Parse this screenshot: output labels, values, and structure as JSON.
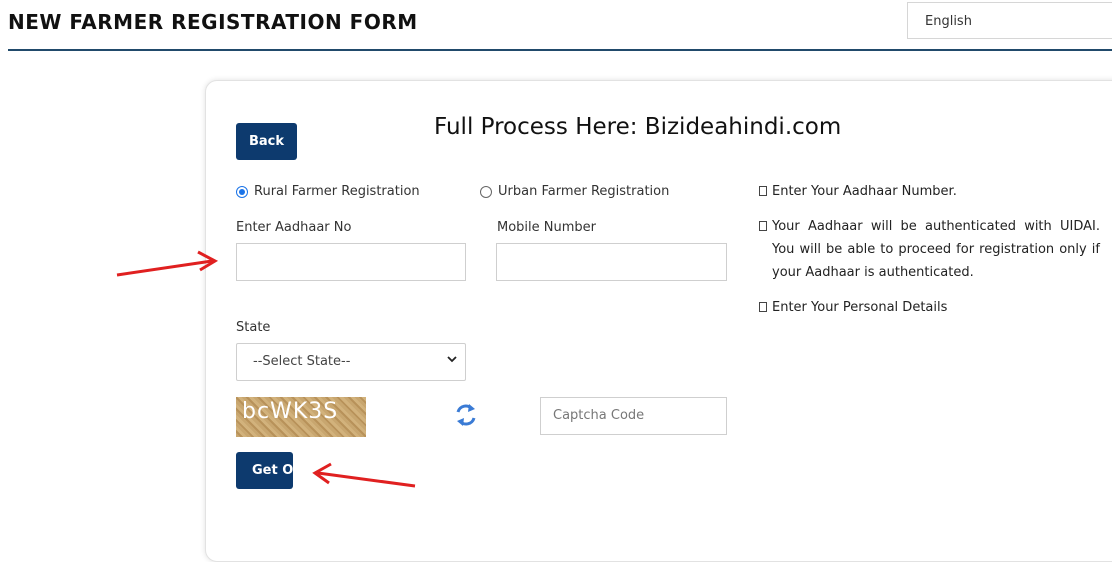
{
  "header": {
    "title": "NEW FARMER REGISTRATION FORM",
    "language": "English"
  },
  "card": {
    "heading": "Full Process Here: Bizideahindi.com",
    "back_label": "Back",
    "otp_label": "Get OTP"
  },
  "registration_type": {
    "options": [
      {
        "label": "Rural Farmer Registration",
        "selected": true
      },
      {
        "label": "Urban Farmer Registration",
        "selected": false
      }
    ]
  },
  "form": {
    "aadhaar_label": "Enter Aadhaar No",
    "aadhaar_value": "",
    "mobile_label": "Mobile Number",
    "mobile_value": "",
    "state_label": "State",
    "state_selected": "--Select State--",
    "captcha_image_text": "bcWK3S",
    "captcha_placeholder": "Captcha Code"
  },
  "instructions": [
    "Enter Your Aadhaar Number.",
    "Your Aadhaar will be authenticated with UIDAI. You will be able to proceed for registration only if your Aadhaar is authenticated.",
    "Enter Your Personal Details"
  ],
  "colors": {
    "primary_button": "#0d3a6e",
    "header_rule": "#214a6b",
    "annotation_arrow": "#e02020",
    "radio_selected": "#1a73e8"
  },
  "icons": {
    "refresh": "refresh-icon",
    "dropdown": "chevron-down-icon"
  }
}
